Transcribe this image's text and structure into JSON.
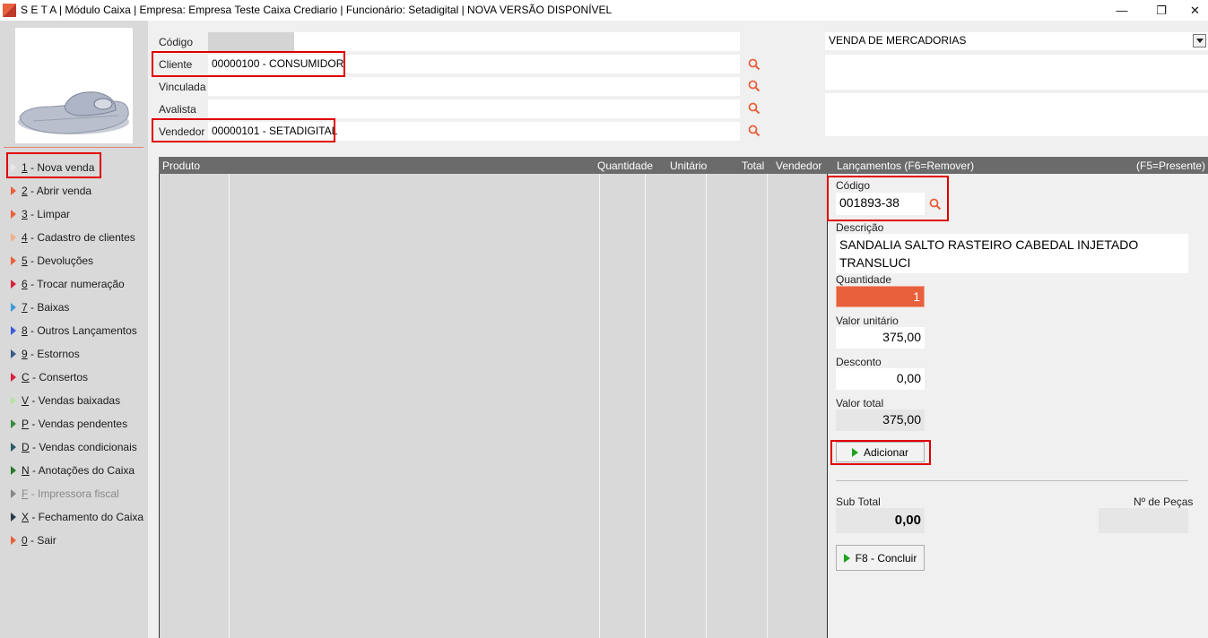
{
  "titlebar": {
    "title": "S E T A | Módulo Caixa | Empresa: Empresa Teste Caixa Crediario | Funcionário: Setadigital  |  NOVA  VERSÃO  DISPONÍVEL",
    "minimize": "—",
    "restore": "❐",
    "close": "✕"
  },
  "menu": [
    {
      "key": "1",
      "label": " - Nova venda",
      "color": "#e8e8e8"
    },
    {
      "key": "2",
      "label": " - Abrir venda",
      "color": "#e8603c"
    },
    {
      "key": "3",
      "label": " - Limpar",
      "color": "#e8603c"
    },
    {
      "key": "4",
      "label": " - Cadastro de clientes",
      "color": "#f0b08a"
    },
    {
      "key": "5",
      "label": " - Devoluções",
      "color": "#e8603c"
    },
    {
      "key": "6",
      "label": " - Trocar numeração",
      "color": "#d9203c"
    },
    {
      "key": "7",
      "label": " - Baixas",
      "color": "#3a9ad9"
    },
    {
      "key": "8",
      "label": " - Outros Lançamentos",
      "color": "#3a5ad9"
    },
    {
      "key": "9",
      "label": " - Estornos",
      "color": "#3a5a8a"
    },
    {
      "key": "C",
      "label": " - Consertos",
      "color": "#d9203c"
    },
    {
      "key": "V",
      "label": " - Vendas baixadas",
      "color": "#b8e0a0"
    },
    {
      "key": "P",
      "label": " - Vendas pendentes",
      "color": "#3a8a3a"
    },
    {
      "key": "D",
      "label": " - Vendas condicionais",
      "color": "#2a5a6a"
    },
    {
      "key": "N",
      "label": " - Anotações do Caixa",
      "color": "#2a7a2a"
    },
    {
      "key": "F",
      "label": " - Impressora fiscal",
      "color": "#888888"
    },
    {
      "key": "X",
      "label": " - Fechamento do Caixa",
      "color": "#2a3a4a"
    },
    {
      "key": "0",
      "label": " - Sair",
      "color": "#e8603c"
    }
  ],
  "header": {
    "codigo_label": "Código",
    "cliente_label": "Cliente",
    "cliente_value": "00000100 - CONSUMIDOR",
    "vinculada_label": "Vinculada",
    "avalista_label": "Avalista",
    "vendedor_label": "Vendedor",
    "vendedor_value": "00000101 - SETADIGITAL",
    "operation_select": "VENDA DE MERCADORIAS"
  },
  "grid": {
    "columns": [
      "Produto",
      "Quantidade",
      "Unitário",
      "Total",
      "Vendedor"
    ],
    "lancamentos_title": "Lançamentos (F6=Remover)",
    "presente_hint": "(F5=Presente)"
  },
  "entry": {
    "codigo_label": "Código",
    "codigo_value": "001893-38",
    "descricao_label": "Descrição",
    "descricao_value": "SANDALIA SALTO RASTEIRO CABEDAL INJETADO TRANSLUCI",
    "quantidade_label": "Quantidade",
    "quantidade_value": "1",
    "valor_unitario_label": "Valor unitário",
    "valor_unitario_value": "375,00",
    "desconto_label": "Desconto",
    "desconto_value": "0,00",
    "valor_total_label": "Valor total",
    "valor_total_value": "375,00",
    "adicionar_label": "Adicionar",
    "subtotal_label": "Sub Total",
    "subtotal_value": "0,00",
    "pecas_label": "Nº de Peças",
    "pecas_value": "",
    "concluir_label": "F8 - Concluir"
  },
  "colors": {
    "highlight": "#e00000",
    "quantity_bg": "#e8603c",
    "grid_header": "#6b6b6b"
  }
}
